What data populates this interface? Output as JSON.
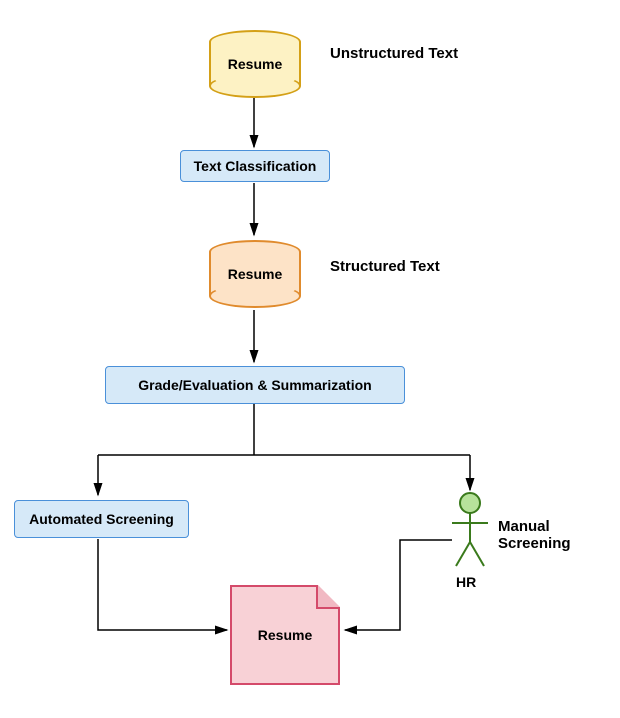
{
  "nodes": {
    "resume1": "Resume",
    "resume2": "Resume",
    "text_classification": "Text Classification",
    "grade_eval": "Grade/Evaluation & Summarization",
    "auto_screening": "Automated Screening",
    "final_resume": "Resume",
    "hr": "HR"
  },
  "labels": {
    "unstructured": "Unstructured Text",
    "structured": "Structured Text",
    "manual": "Manual Screening"
  }
}
